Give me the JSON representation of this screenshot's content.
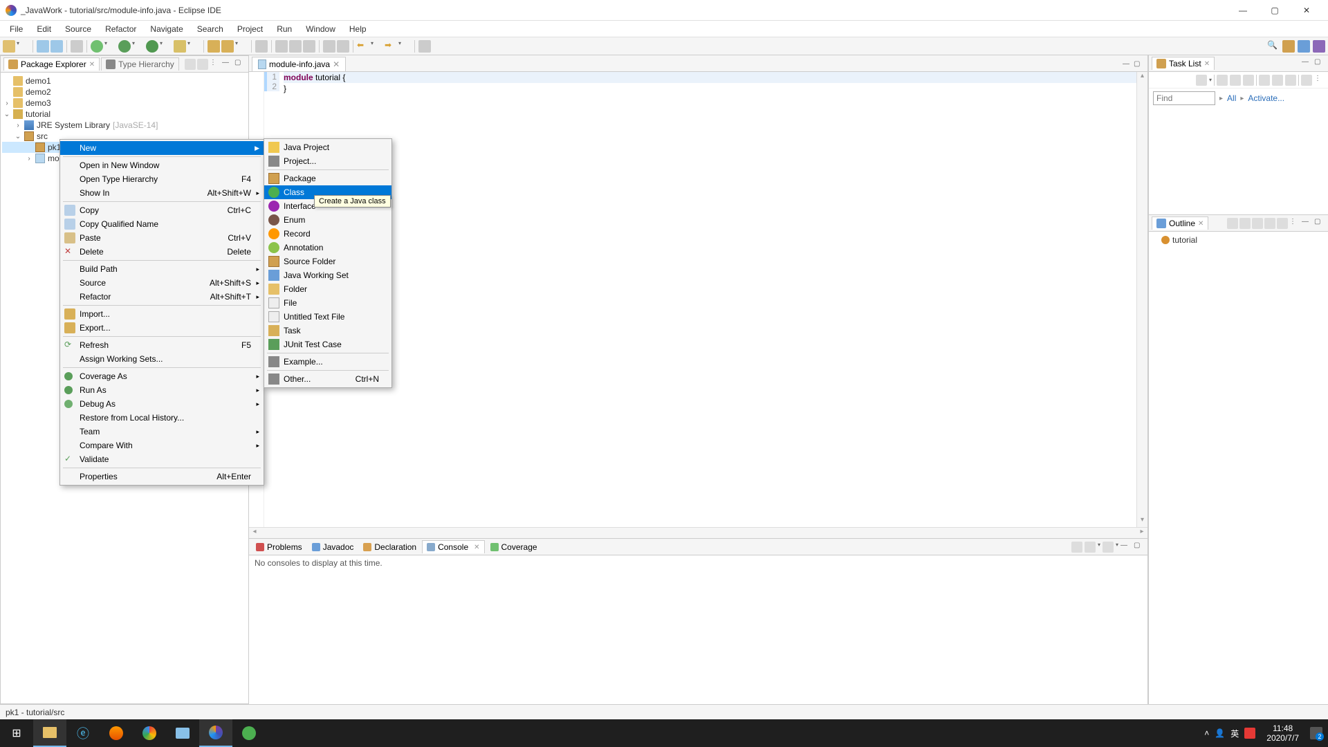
{
  "window": {
    "title": "_JavaWork - tutorial/src/module-info.java - Eclipse IDE"
  },
  "menubar": [
    "File",
    "Edit",
    "Source",
    "Refactor",
    "Navigate",
    "Search",
    "Project",
    "Run",
    "Window",
    "Help"
  ],
  "left_panel": {
    "tabs": [
      {
        "label": "Package Explorer",
        "active": true
      },
      {
        "label": "Type Hierarchy",
        "active": false
      }
    ],
    "tree": {
      "demo1": "demo1",
      "demo2": "demo2",
      "demo3": "demo3",
      "tutorial": "tutorial",
      "jre": "JRE System Library",
      "jre_annot": "[JavaSE-14]",
      "src": "src",
      "pk1": "pk1",
      "mod": "module-info.java"
    }
  },
  "context_menu": {
    "new": "New",
    "open_window": "Open in New Window",
    "open_hierarchy": "Open Type Hierarchy",
    "open_hierarchy_key": "F4",
    "show_in": "Show In",
    "show_in_key": "Alt+Shift+W",
    "copy": "Copy",
    "copy_key": "Ctrl+C",
    "copy_qn": "Copy Qualified Name",
    "paste": "Paste",
    "paste_key": "Ctrl+V",
    "delete": "Delete",
    "delete_key": "Delete",
    "build_path": "Build Path",
    "source": "Source",
    "source_key": "Alt+Shift+S",
    "refactor": "Refactor",
    "refactor_key": "Alt+Shift+T",
    "import": "Import...",
    "export": "Export...",
    "refresh": "Refresh",
    "refresh_key": "F5",
    "assign_ws": "Assign Working Sets...",
    "coverage": "Coverage As",
    "run_as": "Run As",
    "debug_as": "Debug As",
    "restore": "Restore from Local History...",
    "team": "Team",
    "compare": "Compare With",
    "validate": "Validate",
    "properties": "Properties",
    "properties_key": "Alt+Enter"
  },
  "submenu": {
    "java_project": "Java Project",
    "project": "Project...",
    "package": "Package",
    "class": "Class",
    "interface": "Interface",
    "enum": "Enum",
    "record": "Record",
    "annotation": "Annotation",
    "source_folder": "Source Folder",
    "java_ws": "Java Working Set",
    "folder": "Folder",
    "file": "File",
    "untitled": "Untitled Text File",
    "task": "Task",
    "junit": "JUnit Test Case",
    "example": "Example...",
    "other": "Other...",
    "other_key": "Ctrl+N"
  },
  "tooltip": "Create a Java class",
  "editor": {
    "tab": "module-info.java",
    "line1_kw": "module",
    "line1_rest": " tutorial {",
    "line2": "}"
  },
  "bottom": {
    "tabs": [
      "Problems",
      "Javadoc",
      "Declaration",
      "Console",
      "Coverage"
    ],
    "active": 3,
    "body": "No consoles to display at this time."
  },
  "right": {
    "task_tab": "Task List",
    "find_placeholder": "Find",
    "all": "All",
    "activate": "Activate...",
    "outline_tab": "Outline",
    "outline_item": "tutorial"
  },
  "status": "pk1 - tutorial/src",
  "taskbar": {
    "time": "11:48",
    "date": "2020/7/7",
    "ime": "英"
  }
}
